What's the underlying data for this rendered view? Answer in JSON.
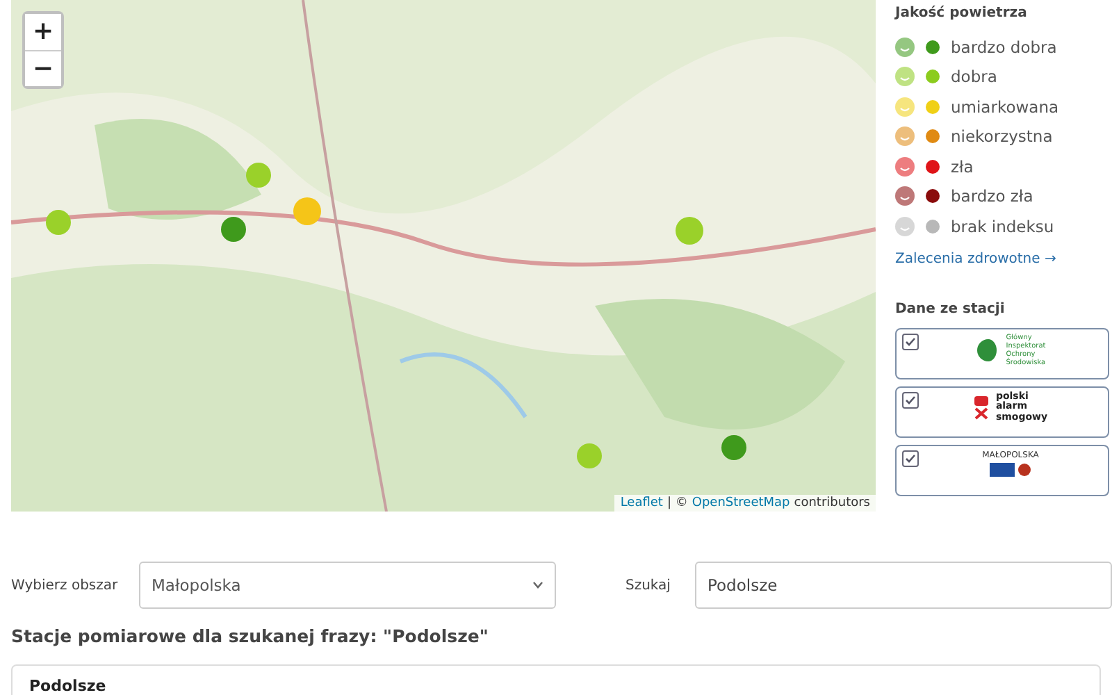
{
  "map": {
    "zoom_in": "+",
    "zoom_out": "−",
    "attribution_link_1": "Leaflet",
    "attribution_sep": "| ©",
    "attribution_link_2": "OpenStreetMap",
    "attribution_text": "contributors"
  },
  "legend": {
    "title": "Jakość powietrza",
    "items": [
      {
        "label": "bardzo dobra",
        "color": "#3f9a1c"
      },
      {
        "label": "dobra",
        "color": "#8ccc1e"
      },
      {
        "label": "umiarkowana",
        "color": "#f0d016"
      },
      {
        "label": "niekorzystna",
        "color": "#e08a12"
      },
      {
        "label": "zła",
        "color": "#df1418"
      },
      {
        "label": "bardzo zła",
        "color": "#8a0b0b"
      },
      {
        "label": "brak indeksu",
        "color": "#b8b8b8"
      }
    ],
    "link": "Zalecenia zdrowotne →"
  },
  "sources": {
    "title": "Dane ze stacji",
    "items": [
      {
        "kind": "gios",
        "checked": true,
        "lines": [
          "Główny",
          "Inspektorat",
          "Ochrony",
          "Środowiska"
        ]
      },
      {
        "kind": "pas",
        "checked": true,
        "lines": [
          "polski",
          "alarm",
          "smogowy"
        ]
      },
      {
        "kind": "malopolska",
        "checked": true,
        "lines": [
          "MAŁOPOLSKA"
        ]
      }
    ]
  },
  "filters": {
    "area_label": "Wybierz obszar",
    "area_value": "Małopolska",
    "search_label": "Szukaj",
    "search_value": "Podolsze"
  },
  "results": {
    "heading": "Stacje pomiarowe dla szukanej frazy: \"Podolsze\"",
    "rows": [
      {
        "name": "Podolsze"
      }
    ]
  }
}
